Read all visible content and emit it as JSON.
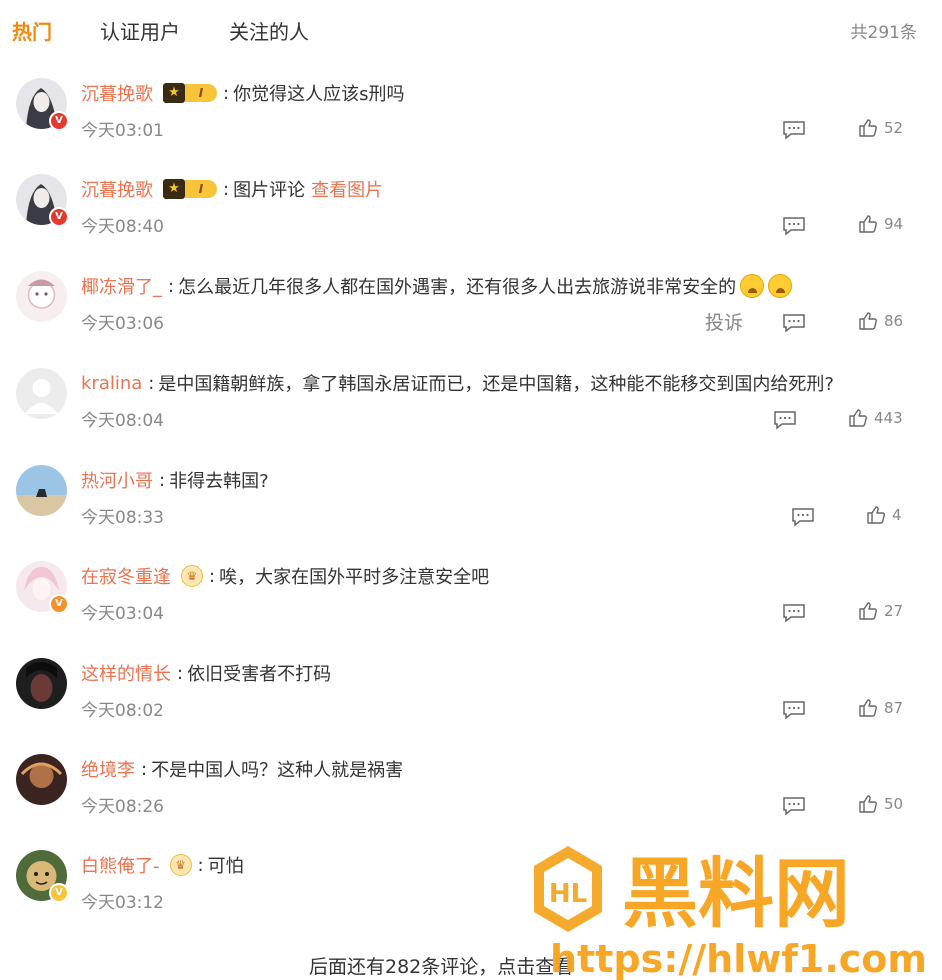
{
  "tabs": [
    {
      "label": "热门"
    },
    {
      "label": "认证用户"
    },
    {
      "label": "关注的人"
    }
  ],
  "total_label": "共291条",
  "comments": [
    {
      "user": "沉暮挽歌",
      "text": "你觉得这人应该s刑吗",
      "link": "",
      "time": "今天03:01",
      "likes": "52",
      "vip_level": "I"
    },
    {
      "user": "沉暮挽歌",
      "text": "图片评论",
      "link": "查看图片",
      "time": "今天08:40",
      "likes": "94",
      "vip_level": "I"
    },
    {
      "user": "椰冻滑了_",
      "text": "怎么最近几年很多人都在国外遇害，还有很多人出去旅游说非常安全的",
      "link": "",
      "time": "今天03:06",
      "likes": "86",
      "report_label": "投诉"
    },
    {
      "user": "kralina",
      "text": "是中国籍朝鲜族，拿了韩国永居证而已，还是中国籍，这种能不能移交到国内给死刑?",
      "link": "",
      "time": "今天08:04",
      "likes": "443"
    },
    {
      "user": "热河小哥",
      "text": "非得去韩国?",
      "link": "",
      "time": "今天08:33",
      "likes": "4"
    },
    {
      "user": "在寂冬重逢",
      "text": "唉，大家在国外平时多注意安全吧",
      "link": "",
      "time": "今天03:04",
      "likes": "27"
    },
    {
      "user": "这样的情长",
      "text": "依旧受害者不打码",
      "link": "",
      "time": "今天08:02",
      "likes": "87"
    },
    {
      "user": "绝境李",
      "text": "不是中国人吗？这种人就是祸害",
      "link": "",
      "time": "今天08:26",
      "likes": "50"
    },
    {
      "user": "白熊俺了-",
      "text": "可怕",
      "link": "",
      "time": "今天03:12",
      "likes": ""
    }
  ],
  "more_comments_label": "后面还有282条评论，点击查看",
  "watermark": {
    "title": "黑料网",
    "url": "https://hlwf1.com"
  },
  "colors": {
    "accent": "#f28a12",
    "username": "#eb7350",
    "muted": "#888888"
  }
}
